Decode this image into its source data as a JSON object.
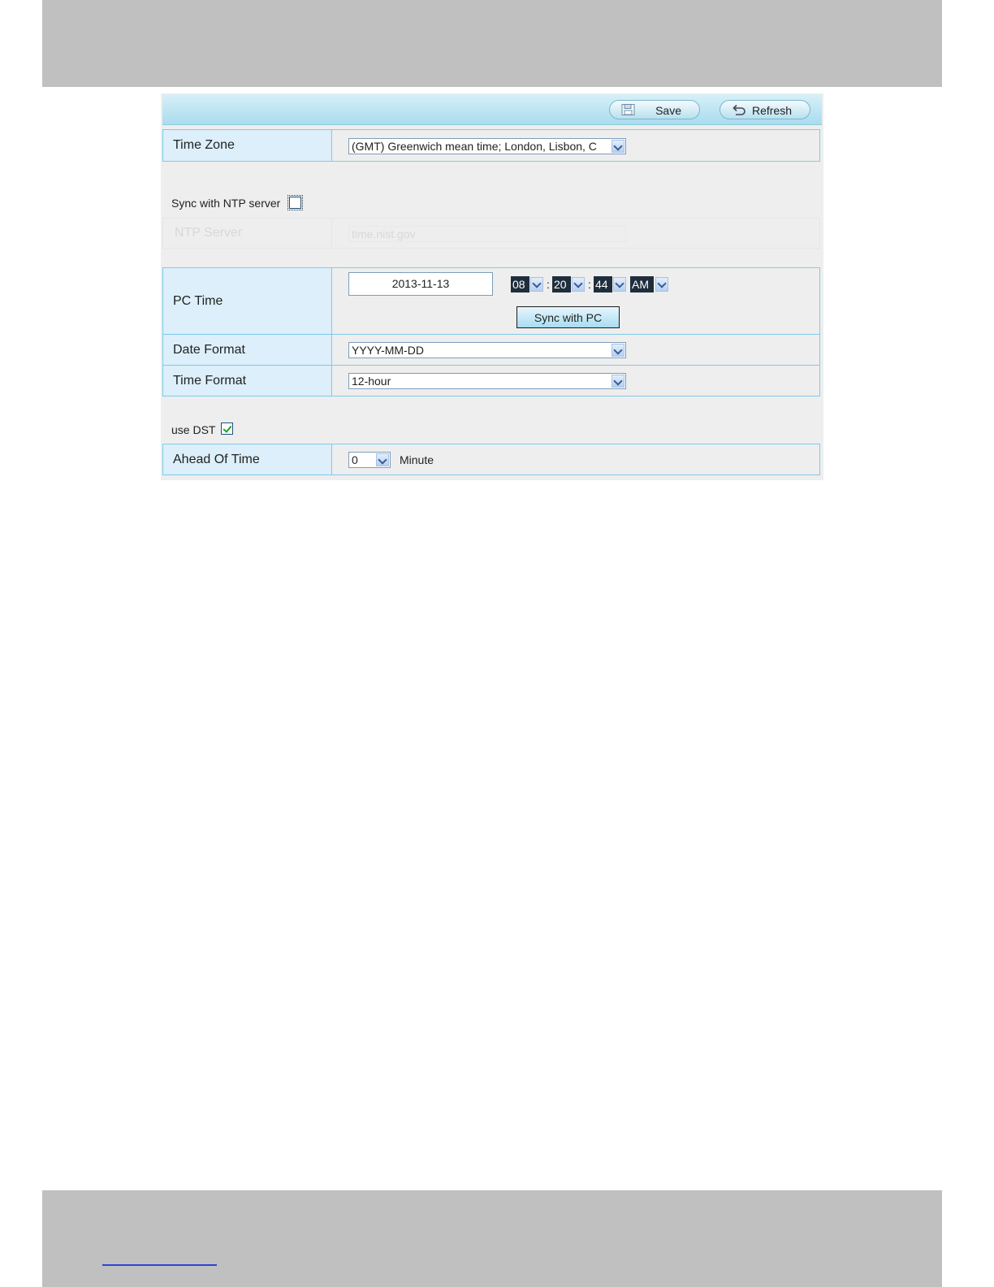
{
  "toolbar": {
    "save_label": "Save",
    "refresh_label": "Refresh"
  },
  "time_zone": {
    "label": "Time Zone",
    "value": "(GMT) Greenwich mean time; London, Lisbon, C"
  },
  "ntp": {
    "sync_label": "Sync with NTP server",
    "sync_checked": false,
    "server_label": "NTP Server",
    "server_value": "time.nist.gov"
  },
  "pc_time": {
    "label": "PC Time",
    "date": "2013-11-13",
    "hour": "08",
    "minute": "20",
    "second": "44",
    "ampm": "AM",
    "separator": ":",
    "sync_button": "Sync with PC"
  },
  "date_format": {
    "label": "Date Format",
    "value": "YYYY-MM-DD"
  },
  "time_format": {
    "label": "Time Format",
    "value": "12-hour"
  },
  "dst": {
    "label": "use DST",
    "checked": true
  },
  "ahead_of_time": {
    "label": "Ahead Of Time",
    "value": "0",
    "unit": "Minute"
  }
}
